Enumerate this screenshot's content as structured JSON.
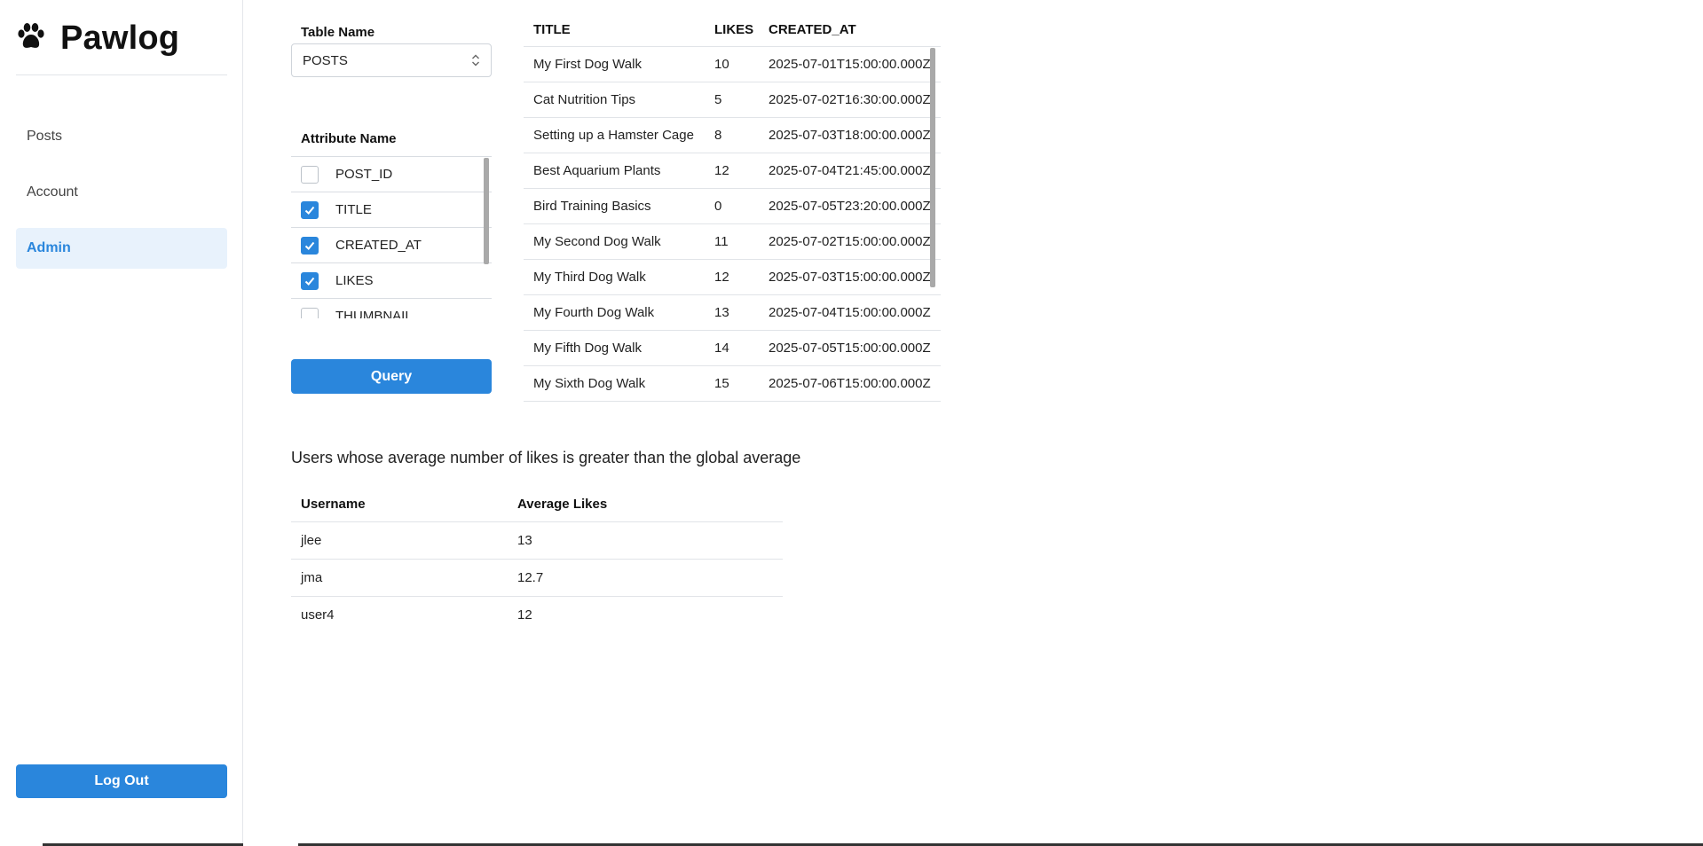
{
  "app": {
    "name": "Pawlog"
  },
  "sidebar": {
    "items": [
      {
        "label": "Posts"
      },
      {
        "label": "Account"
      },
      {
        "label": "Admin",
        "active": true
      }
    ],
    "logout_label": "Log Out"
  },
  "query_panel": {
    "table_name_label": "Table Name",
    "table_name_value": "POSTS",
    "attribute_label": "Attribute Name",
    "attributes": [
      {
        "name": "POST_ID",
        "checked": false
      },
      {
        "name": "TITLE",
        "checked": true
      },
      {
        "name": "CREATED_AT",
        "checked": true
      },
      {
        "name": "LIKES",
        "checked": true
      },
      {
        "name": "THUMBNAIL",
        "checked": false
      }
    ],
    "query_label": "Query"
  },
  "results": {
    "columns": [
      "TITLE",
      "LIKES",
      "CREATED_AT"
    ],
    "rows": [
      [
        "My First Dog Walk",
        "10",
        "2025-07-01T15:00:00.000Z"
      ],
      [
        "Cat Nutrition Tips",
        "5",
        "2025-07-02T16:30:00.000Z"
      ],
      [
        "Setting up a Hamster Cage",
        "8",
        "2025-07-03T18:00:00.000Z"
      ],
      [
        "Best Aquarium Plants",
        "12",
        "2025-07-04T21:45:00.000Z"
      ],
      [
        "Bird Training Basics",
        "0",
        "2025-07-05T23:20:00.000Z"
      ],
      [
        "My Second Dog Walk",
        "11",
        "2025-07-02T15:00:00.000Z"
      ],
      [
        "My Third Dog Walk",
        "12",
        "2025-07-03T15:00:00.000Z"
      ],
      [
        "My Fourth Dog Walk",
        "13",
        "2025-07-04T15:00:00.000Z"
      ],
      [
        "My Fifth Dog Walk",
        "14",
        "2025-07-05T15:00:00.000Z"
      ],
      [
        "My Sixth Dog Walk",
        "15",
        "2025-07-06T15:00:00.000Z"
      ]
    ]
  },
  "users_section": {
    "heading": "Users whose average number of likes is greater than the global average",
    "columns": [
      "Username",
      "Average Likes"
    ],
    "rows": [
      [
        "jlee",
        "13"
      ],
      [
        "jma",
        "12.7"
      ],
      [
        "user4",
        "12"
      ]
    ]
  },
  "colors": {
    "accent": "#2a86dc",
    "active_bg": "#e8f2fc"
  }
}
